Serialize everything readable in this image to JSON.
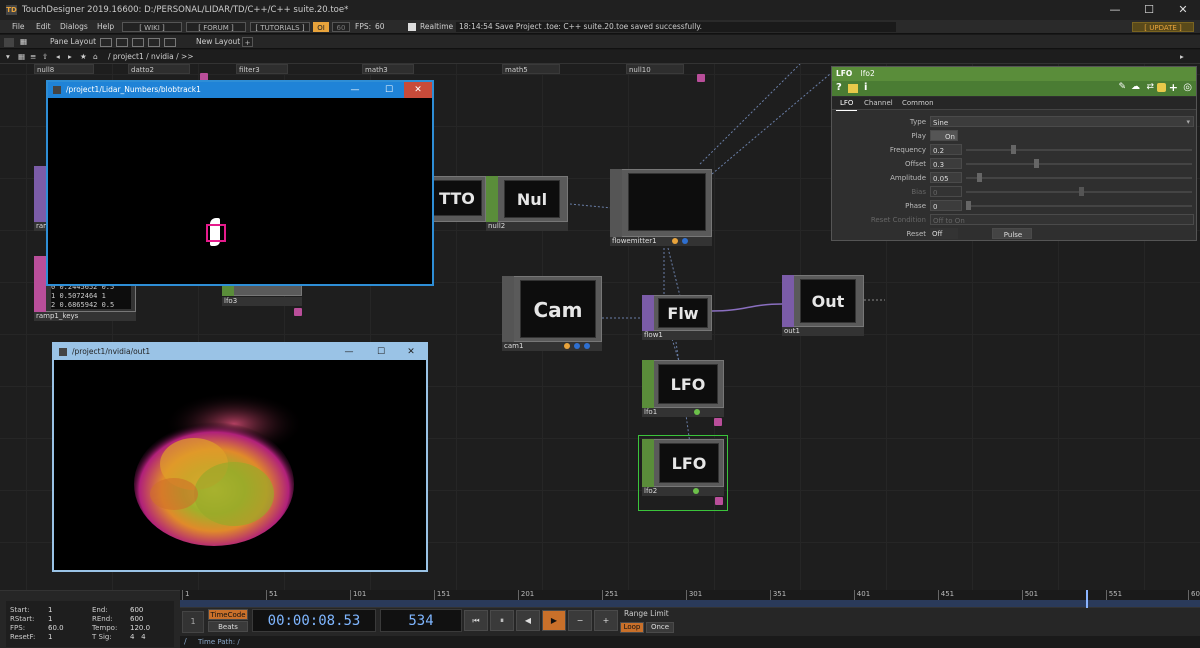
{
  "titlebar": {
    "title": "TouchDesigner 2019.16600: D:/PERSONAL/LIDAR/TD/C++/C++ suite.20.toe*",
    "minimize": "—",
    "maximize": "☐",
    "close": "✕"
  },
  "menubar": {
    "items": [
      "File",
      "Edit",
      "Dialogs",
      "Help"
    ],
    "wiki": "[ WIKI ]",
    "forum": "[ FORUM ]",
    "tutorials": "[ TUTORIALS ]",
    "oi": "OI",
    "fps_a": "60",
    "fps_label": "FPS:",
    "fps_value": "60",
    "realtime": "Realtime",
    "status": "18:14:54 Save Project .toe: C++ suite.20.toe saved successfully.",
    "update": "[ UPDATE ]"
  },
  "toolbar": {
    "pane_layout": "Pane Layout",
    "new_layout": "New Layout",
    "add": "+"
  },
  "pathbar": {
    "path": "/ project1 / nvidia / >>"
  },
  "topnodes": [
    "null8",
    "datto2",
    "filter3",
    "math3",
    "math5",
    "null10"
  ],
  "nodes": {
    "tto": {
      "label": "TTO"
    },
    "null2": {
      "label": "Nul",
      "name": "null2"
    },
    "flowemitter1": {
      "name": "flowemitter1"
    },
    "cam1": {
      "label": "Cam",
      "name": "cam1"
    },
    "flow1": {
      "label": "Flw",
      "name": "flow1"
    },
    "out1": {
      "label": "Out",
      "name": "out1"
    },
    "lfo1": {
      "label": "LFO",
      "name": "lfo1"
    },
    "lfo2": {
      "label": "LFO",
      "name": "lfo2"
    },
    "lfo3": {
      "name": "lfo3"
    },
    "ramp1_keys": {
      "name": "ramp1_keys",
      "rows": [
        [
          "0",
          "0.2445652",
          "0.5"
        ],
        [
          "1",
          "0.5072464",
          "1"
        ],
        [
          "2",
          "0.6865942",
          "0.5"
        ]
      ]
    },
    "ram": {
      "name": "ram"
    }
  },
  "windows": {
    "blobtrack": {
      "title": "/project1/Lidar_Numbers/blobtrack1"
    },
    "out": {
      "title": "/project1/nvidia/out1"
    }
  },
  "params": {
    "op_type": "LFO",
    "op_name": "lfo2",
    "tabs": [
      "LFO",
      "Channel",
      "Common"
    ],
    "rows": [
      {
        "label": "Type",
        "value": "Sine"
      },
      {
        "label": "Play",
        "value": "On"
      },
      {
        "label": "Frequency",
        "value": "0.2"
      },
      {
        "label": "Offset",
        "value": "0.3"
      },
      {
        "label": "Amplitude",
        "value": "0.05"
      },
      {
        "label": "Bias",
        "value": "0"
      },
      {
        "label": "Phase",
        "value": "0"
      },
      {
        "label": "Reset Condition",
        "value": "Off to On"
      },
      {
        "label": "Reset",
        "value": "Off",
        "pulse": "Pulse"
      }
    ],
    "slider_levels": {
      "frequency": 0.2,
      "offset": 0.3,
      "amplitude": 0.05,
      "bias": 0.5,
      "phase": 0
    }
  },
  "timeline": {
    "ticks": [
      "1",
      "51",
      "101",
      "151",
      "201",
      "251",
      "301",
      "351",
      "401",
      "451",
      "501",
      "551",
      "600"
    ],
    "stats_left": [
      [
        "Start:",
        "1"
      ],
      [
        "RStart:",
        "1"
      ],
      [
        "FPS:",
        "60.0"
      ],
      [
        "ResetF:",
        "1"
      ]
    ],
    "stats_right": [
      [
        "End:",
        "600"
      ],
      [
        "REnd:",
        "600"
      ],
      [
        "Tempo:",
        "120.0"
      ],
      [
        "T Sig:",
        "4   4"
      ]
    ],
    "timecode": "TimeCode",
    "beats": "Beats",
    "time": "00:00:08.53",
    "frame": "534",
    "range_limit": "Range Limit",
    "loop": "Loop",
    "once": "Once",
    "time_path": "Time Path: /",
    "buttons": [
      "⏮",
      "⏸",
      "◀",
      "▶",
      "−",
      "+"
    ],
    "one": "1"
  },
  "colors": {
    "accent_blue": "#1f83d7",
    "green": "#5a8d3a",
    "orange": "#e8a33b",
    "purple": "#7b5ca8",
    "pink": "#b94e9a"
  }
}
